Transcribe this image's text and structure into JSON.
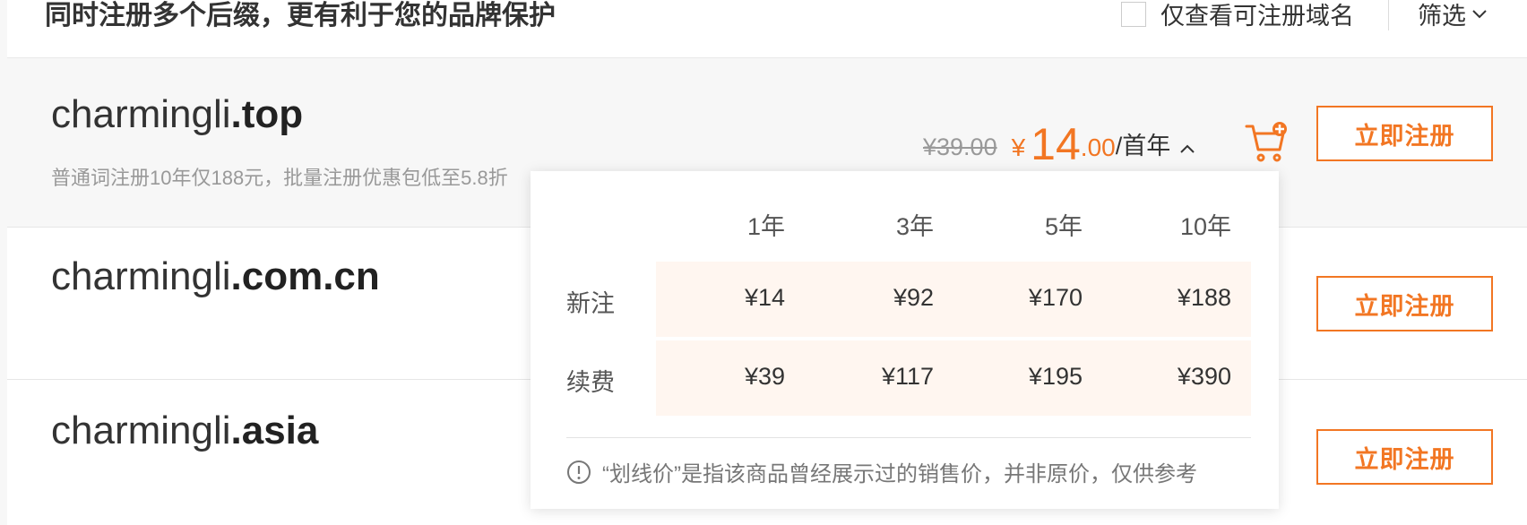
{
  "header": {
    "title": "同时注册多个后缀，更有利于您的品牌保护",
    "filter_checkbox_label": "仅查看可注册域名",
    "filter_dropdown_label": "筛选"
  },
  "rows": [
    {
      "domain_name": "charmingli",
      "domain_suffix": ".top",
      "promo": "普通词注册10年仅188元，批量注册优惠包低至5.8折",
      "price": {
        "old": "¥39.00",
        "currency": "¥",
        "integer": "14",
        "decimal": ".00",
        "unit": "/首年"
      },
      "register_label": "立即注册"
    },
    {
      "domain_name": "charmingli",
      "domain_suffix": ".com.cn",
      "register_label": "立即注册"
    },
    {
      "domain_name": "charmingli",
      "domain_suffix": ".asia",
      "register_label": "立即注册"
    }
  ],
  "price_popover": {
    "years": [
      "1年",
      "3年",
      "5年",
      "10年"
    ],
    "row_labels": [
      "新注",
      "续费"
    ],
    "new_prices": [
      "¥14",
      "¥92",
      "¥170",
      "¥188"
    ],
    "renew_prices": [
      "¥39",
      "¥117",
      "¥195",
      "¥390"
    ],
    "note": "“划线价”是指该商品曾经展示过的销售价，并非原价，仅供参考"
  },
  "colors": {
    "accent": "#f27623",
    "row_highlight_bg": "#f7f7f7",
    "table_band_bg": "#fff6f0"
  }
}
